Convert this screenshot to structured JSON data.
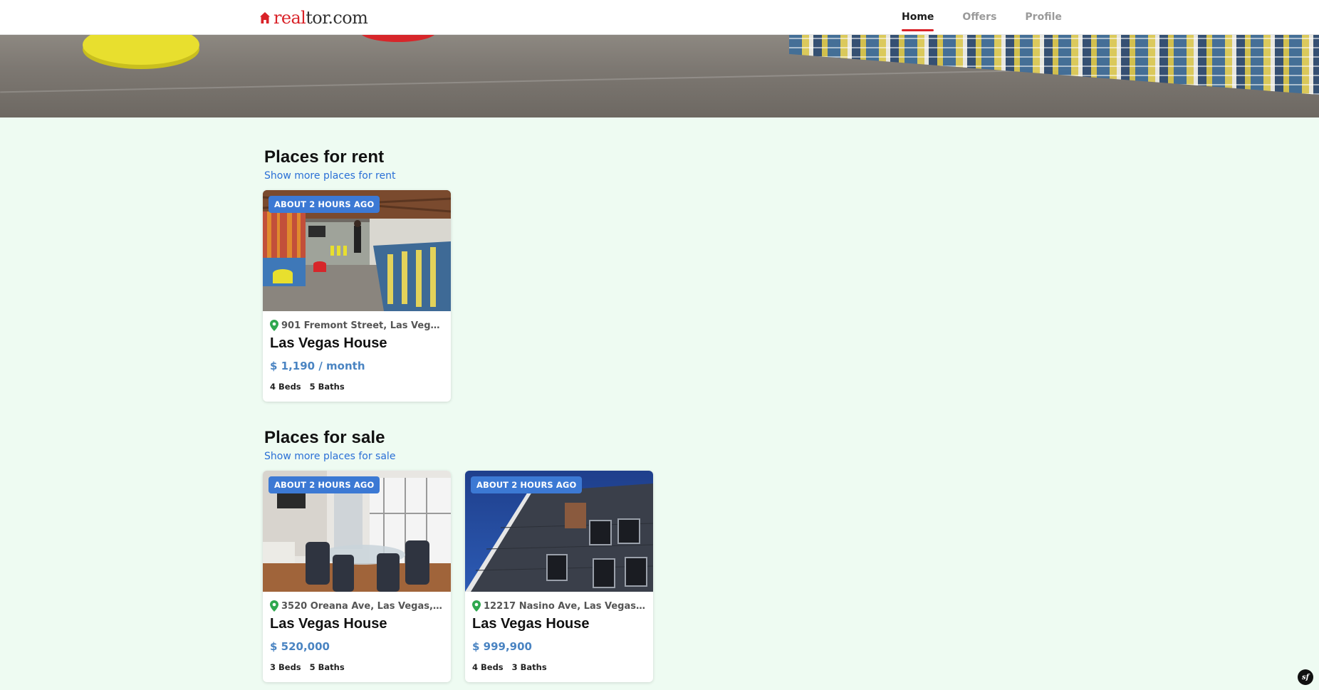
{
  "header": {
    "logo": {
      "part1": "real",
      "part2": "tor.com"
    },
    "nav": [
      {
        "label": "Home",
        "active": true
      },
      {
        "label": "Offers",
        "active": false
      },
      {
        "label": "Profile",
        "active": false
      }
    ]
  },
  "colors": {
    "brand_red": "#d92228",
    "badge_blue": "#3c79d4",
    "price_blue": "#4a84c2",
    "link_blue": "#2a6fd6",
    "page_bg": "#eefbf2",
    "pin_green": "#2fa84f"
  },
  "rent": {
    "title": "Places for rent",
    "link": "Show more places for rent",
    "cards": [
      {
        "badge": "ABOUT 2 HOURS AGO",
        "address": "901 Fremont Street, Las Vegas, ...",
        "title": "Las Vegas House",
        "price": "$ 1,190 / month",
        "beds": "4 Beds",
        "baths": "5 Baths"
      }
    ]
  },
  "sale": {
    "title": "Places for sale",
    "link": "Show more places for sale",
    "cards": [
      {
        "badge": "ABOUT 2 HOURS AGO",
        "address": "3520 Oreana Ave, Las Vegas, N...",
        "title": "Las Vegas House",
        "price": "$ 520,000",
        "beds": "3 Beds",
        "baths": "5 Baths"
      },
      {
        "badge": "ABOUT 2 HOURS AGO",
        "address": "12217 Nasino Ave, Las Vegas, N...",
        "title": "Las Vegas House",
        "price": "$ 999,900",
        "beds": "4 Beds",
        "baths": "3 Baths"
      }
    ]
  },
  "footer_badge": {
    "label": "sf"
  }
}
